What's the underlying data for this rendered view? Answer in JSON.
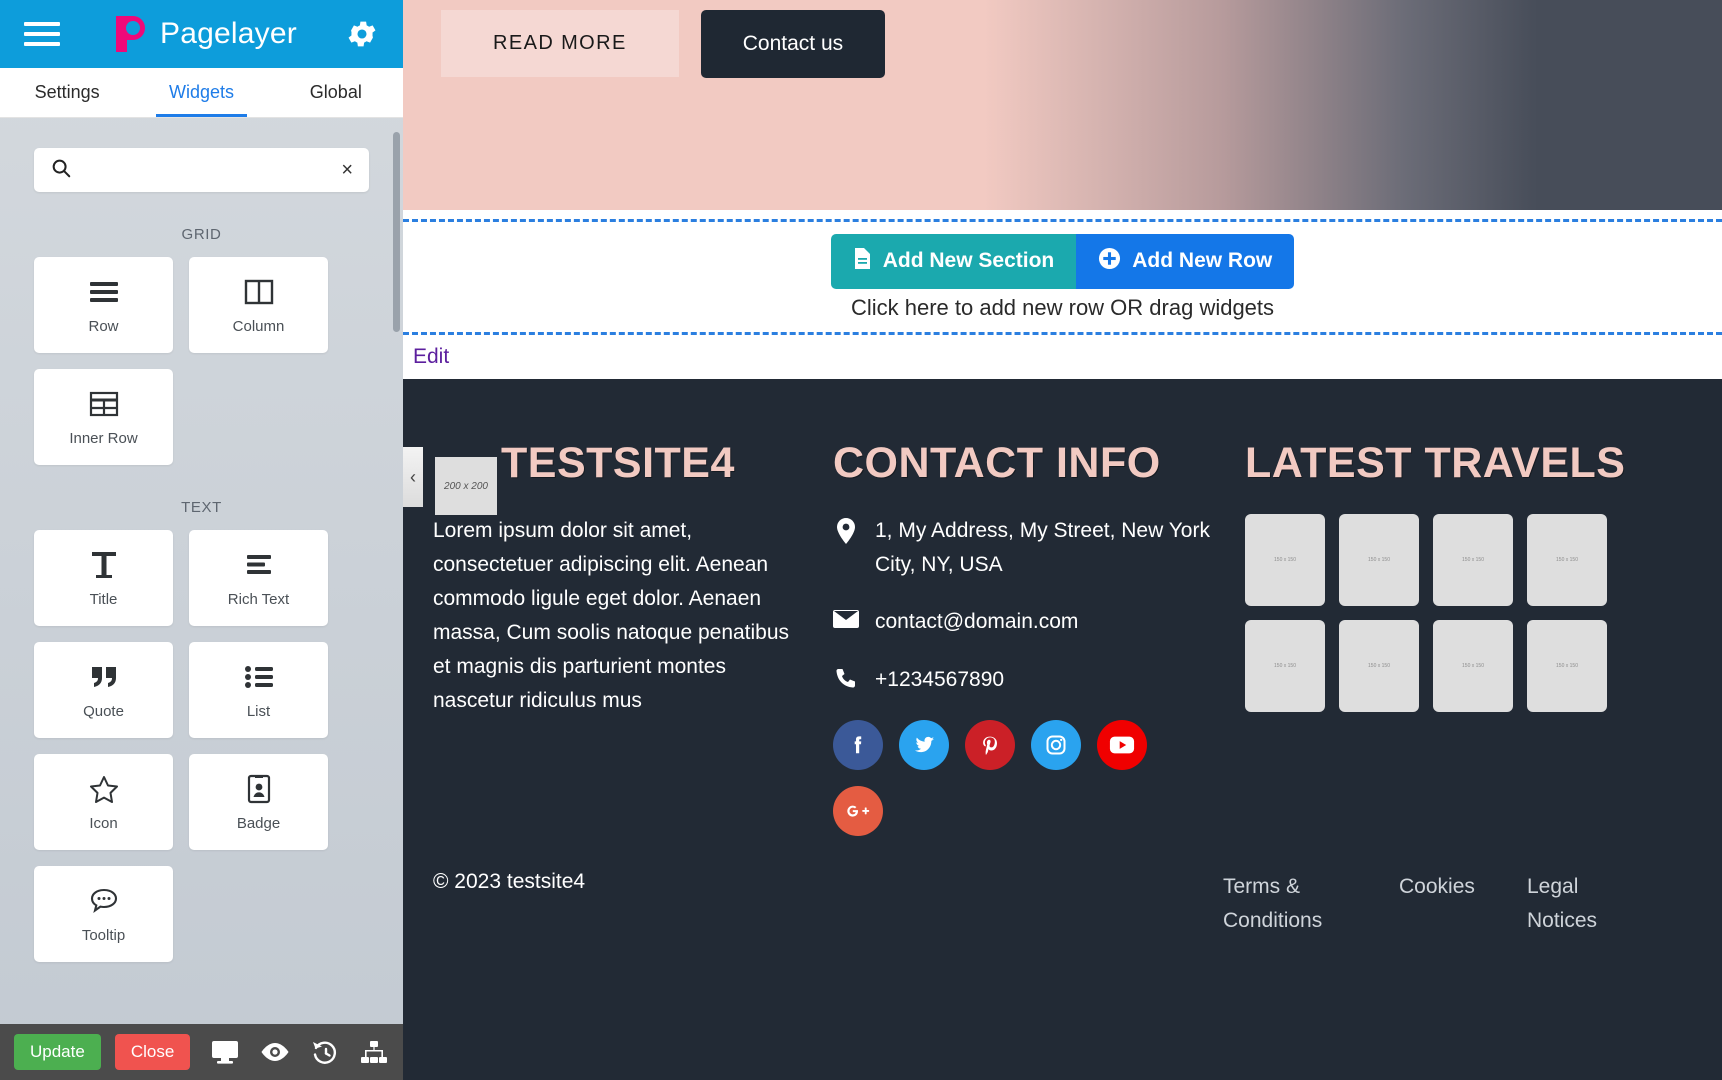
{
  "app": {
    "brand_name": "Pagelayer",
    "menu_icon": "hamburger-icon",
    "settings_icon": "gear-icon"
  },
  "tabs": [
    {
      "label": "Settings",
      "active": false
    },
    {
      "label": "Widgets",
      "active": true
    },
    {
      "label": "Global",
      "active": false
    }
  ],
  "search": {
    "value": "",
    "placeholder": "",
    "clear_label": "×"
  },
  "widget_groups": [
    {
      "label": "GRID",
      "widgets": [
        {
          "label": "Row",
          "icon": "rows-icon"
        },
        {
          "label": "Column",
          "icon": "column-icon"
        },
        {
          "label": "Inner Row",
          "icon": "inner-row-icon"
        }
      ]
    },
    {
      "label": "TEXT",
      "widgets": [
        {
          "label": "Title",
          "icon": "title-icon"
        },
        {
          "label": "Rich Text",
          "icon": "rich-text-icon"
        },
        {
          "label": "Quote",
          "icon": "quote-icon"
        },
        {
          "label": "List",
          "icon": "list-icon"
        },
        {
          "label": "Icon",
          "icon": "star-icon"
        },
        {
          "label": "Badge",
          "icon": "badge-icon"
        },
        {
          "label": "Tooltip",
          "icon": "tooltip-icon"
        }
      ]
    }
  ],
  "editor_footer": {
    "update_label": "Update",
    "close_label": "Close",
    "icons": [
      {
        "name": "desktop-icon"
      },
      {
        "name": "preview-eye-icon"
      },
      {
        "name": "revision-history-icon"
      },
      {
        "name": "sitemap-icon"
      }
    ]
  },
  "hero": {
    "read_more_label": "READ MORE",
    "contact_label": "Contact us"
  },
  "add_zone": {
    "section_label": "Add New Section",
    "row_label": "Add New Row",
    "hint": "Click here to add new row OR drag widgets",
    "section_icon": "document-icon",
    "row_icon": "plus-circle-icon"
  },
  "edit_bar": {
    "edit_label": "Edit"
  },
  "site_footer": {
    "collapse_icon": "chevron-left-icon",
    "logo_placeholder": "200 x 200",
    "brand": {
      "title": "TESTSITE4",
      "paragraph": "Lorem ipsum dolor sit amet, consectetuer adipiscing elit. Aenean commodo ligule eget dolor. Aenaen massa, Cum soolis natoque penatibus et magnis dis parturient montes nascetur ridiculus mus"
    },
    "contact": {
      "title": "CONTACT INFO",
      "address": "1, My Address, My Street, New York City, NY, USA",
      "address_icon": "map-pin-icon",
      "email": "contact@domain.com",
      "email_icon": "envelope-icon",
      "phone": "+1234567890",
      "phone_icon": "phone-icon",
      "socials": [
        {
          "name": "facebook",
          "glyph": "f",
          "color": "#3b5998"
        },
        {
          "name": "twitter",
          "glyph": "t",
          "color": "#2aa3ef"
        },
        {
          "name": "pinterest",
          "glyph": "p",
          "color": "#cb2027"
        },
        {
          "name": "instagram",
          "glyph": "i",
          "color": "#2aa3ef"
        },
        {
          "name": "youtube",
          "glyph": "y",
          "color": "#f00000"
        },
        {
          "name": "googleplus",
          "glyph": "g",
          "color": "#e45c42"
        }
      ]
    },
    "travels": {
      "title": "LATEST TRAVELS",
      "item_label": "150 x 150",
      "count": 8
    },
    "copyright": "© 2023 testsite4",
    "links": [
      {
        "label": "Terms & Conditions"
      },
      {
        "label": "Cookies"
      },
      {
        "label": "Legal Notices"
      }
    ]
  },
  "colors": {
    "brand_blue": "#0d9ddb",
    "brand_pink": "#ee0979",
    "accent_pink": "#f2cac2",
    "footer_bg": "#222a35",
    "update_green": "#4caf50",
    "close_red": "#f0534f",
    "add_section_teal": "#1ba9ae",
    "add_row_blue": "#1477e8",
    "edit_purple": "#5c1f9e"
  }
}
